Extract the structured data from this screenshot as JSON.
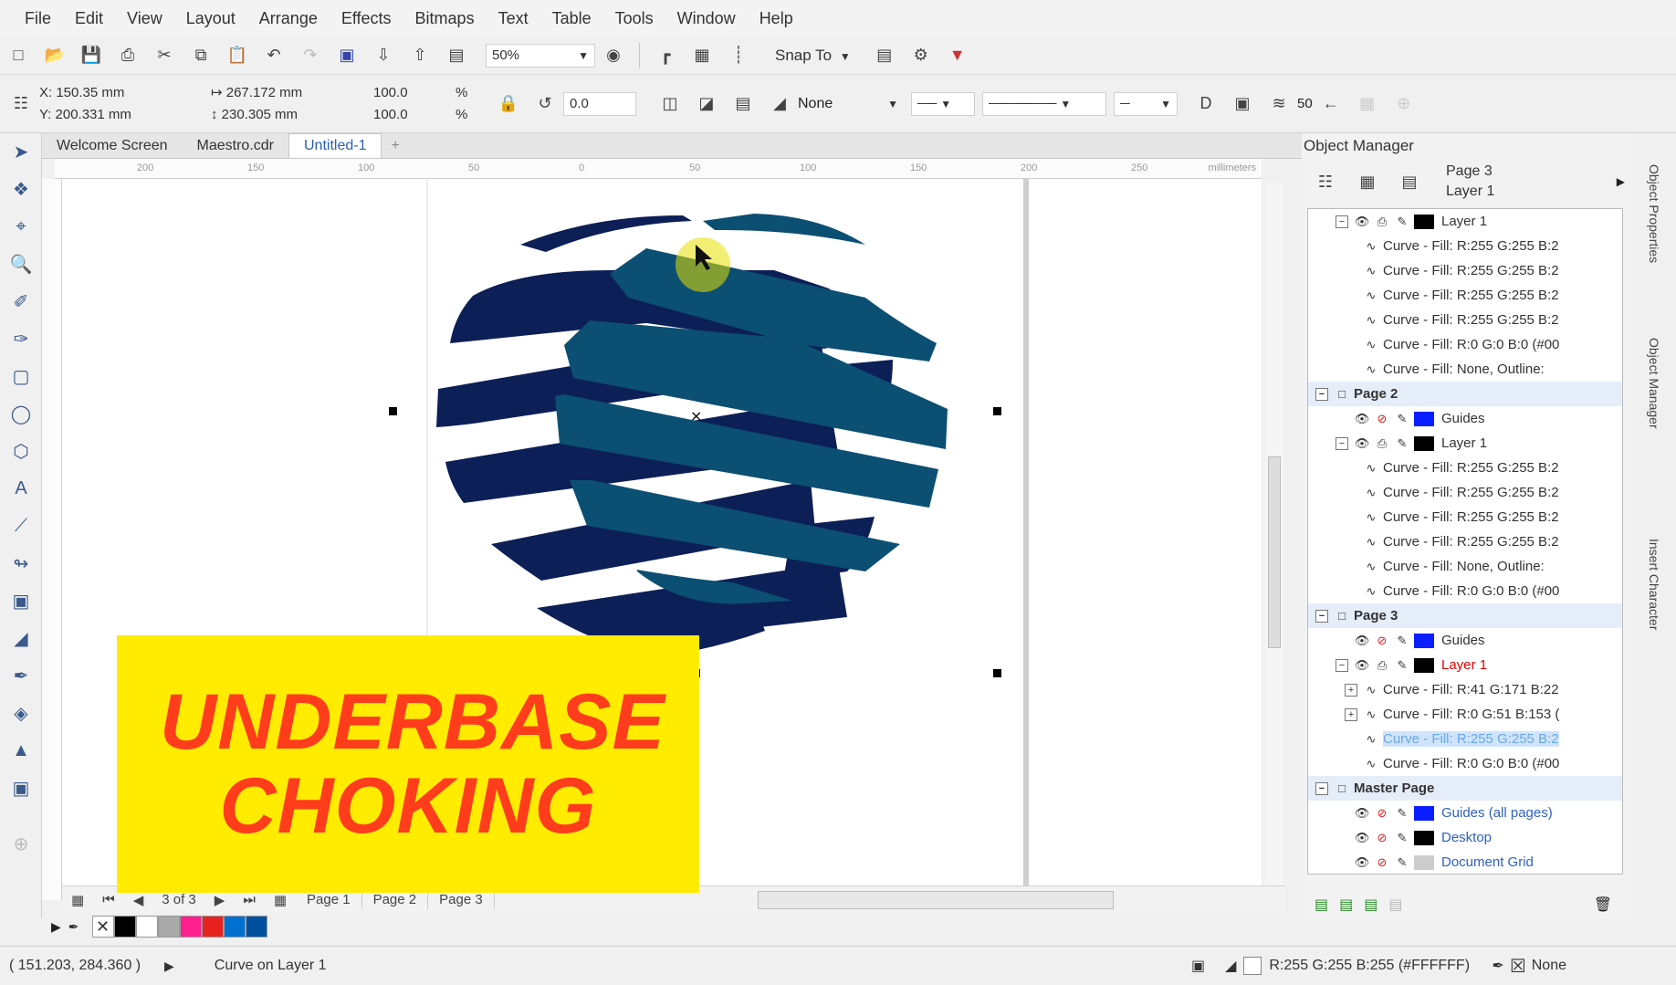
{
  "menu": [
    "File",
    "Edit",
    "View",
    "Layout",
    "Arrange",
    "Effects",
    "Bitmaps",
    "Text",
    "Table",
    "Tools",
    "Window",
    "Help"
  ],
  "toolbar": {
    "zoom": "50%",
    "snap_to": "Snap To"
  },
  "property_bar": {
    "x": "X: 150.35 mm",
    "y": "Y: 200.331 mm",
    "width": "267.172 mm",
    "height": "230.305 mm",
    "scale_x": "100.0",
    "scale_y": "100.0",
    "pct": "%",
    "rotation": "0.0",
    "fill": "None",
    "smoothing": "50"
  },
  "doc_tabs": [
    "Welcome Screen",
    "Maestro.cdr",
    "Untitled-1",
    "+"
  ],
  "active_tab": "Untitled-1",
  "ruler": {
    "h_ticks": [
      "200",
      "150",
      "100",
      "50",
      "0",
      "50",
      "100",
      "150",
      "200",
      "250"
    ],
    "unit": "millimeters"
  },
  "page_nav": {
    "counter": "3 of 3",
    "pages": [
      "Page 1",
      "Page 2",
      "Page 3"
    ]
  },
  "palette": [
    "#ffffff",
    "#000000",
    "#ffffff",
    "#aaaaaa",
    "#ff1f8f",
    "#e8231f",
    "#0070d0",
    "#0050a0"
  ],
  "status": {
    "coords": "( 151.203, 284.360 )",
    "selection": "Curve on Layer 1",
    "fill_info": "R:255 G:255 B:255 (#FFFFFF)",
    "outline": "None"
  },
  "object_manager": {
    "title": "Object Manager",
    "page_label": "Page 3",
    "layer_label": "Layer 1",
    "tree": [
      {
        "kind": "layer",
        "label": "Layer 1",
        "indent": 1,
        "color": "#000000"
      },
      {
        "kind": "curve",
        "label": "Curve - Fill: R:255 G:255 B:2",
        "indent": 2
      },
      {
        "kind": "curve",
        "label": "Curve - Fill: R:255 G:255 B:2",
        "indent": 2
      },
      {
        "kind": "curve",
        "label": "Curve - Fill: R:255 G:255 B:2",
        "indent": 2
      },
      {
        "kind": "curve",
        "label": "Curve - Fill: R:255 G:255 B:2",
        "indent": 2
      },
      {
        "kind": "curve",
        "label": "Curve - Fill: R:0 G:0 B:0 (#00",
        "indent": 2
      },
      {
        "kind": "curve",
        "label": "Curve - Fill: None, Outline:",
        "indent": 2
      },
      {
        "kind": "page",
        "label": "Page 2",
        "indent": 0
      },
      {
        "kind": "guides",
        "label": "Guides",
        "indent": 1,
        "color": "#0a1eff"
      },
      {
        "kind": "layer",
        "label": "Layer 1",
        "indent": 1,
        "color": "#000000"
      },
      {
        "kind": "curve",
        "label": "Curve - Fill: R:255 G:255 B:2",
        "indent": 2
      },
      {
        "kind": "curve",
        "label": "Curve - Fill: R:255 G:255 B:2",
        "indent": 2
      },
      {
        "kind": "curve",
        "label": "Curve - Fill: R:255 G:255 B:2",
        "indent": 2
      },
      {
        "kind": "curve",
        "label": "Curve - Fill: R:255 G:255 B:2",
        "indent": 2
      },
      {
        "kind": "curve",
        "label": "Curve - Fill: None, Outline:",
        "indent": 2
      },
      {
        "kind": "curve",
        "label": "Curve - Fill: R:0 G:0 B:0 (#00",
        "indent": 2
      },
      {
        "kind": "page",
        "label": "Page 3",
        "indent": 0
      },
      {
        "kind": "guides",
        "label": "Guides",
        "indent": 1,
        "color": "#0a1eff"
      },
      {
        "kind": "layer",
        "label": "Layer 1",
        "indent": 1,
        "color": "#000000",
        "red": true
      },
      {
        "kind": "curve",
        "label": "Curve - Fill: R:41 G:171 B:22",
        "indent": 2,
        "plus": true
      },
      {
        "kind": "curve",
        "label": "Curve - Fill: R:0 G:51 B:153 (",
        "indent": 2,
        "plus": true
      },
      {
        "kind": "curve",
        "label": "Curve - Fill: R:255 G:255 B:2",
        "indent": 2,
        "selected": true
      },
      {
        "kind": "curve",
        "label": "Curve - Fill: R:0 G:0 B:0 (#00",
        "indent": 2
      },
      {
        "kind": "page",
        "label": "Master Page",
        "indent": 0
      },
      {
        "kind": "guides",
        "label": "Guides (all pages)",
        "indent": 1,
        "color": "#0a1eff",
        "blue": true
      },
      {
        "kind": "guides",
        "label": "Desktop",
        "indent": 1,
        "color": "#000000",
        "blue": true
      },
      {
        "kind": "guides",
        "label": "Document Grid",
        "indent": 1,
        "color": "#cccccc",
        "blue": true
      }
    ]
  },
  "side_tabs": [
    "Object Properties",
    "Object Manager",
    "Insert Character"
  ],
  "banner": {
    "line1": "UNDERBASE",
    "line2": "CHOKING"
  },
  "colors": {
    "navy": "#0c1f56",
    "teal": "#0b4f72",
    "banner_bg": "#ffec00",
    "banner_text": "#ff3c1c"
  }
}
